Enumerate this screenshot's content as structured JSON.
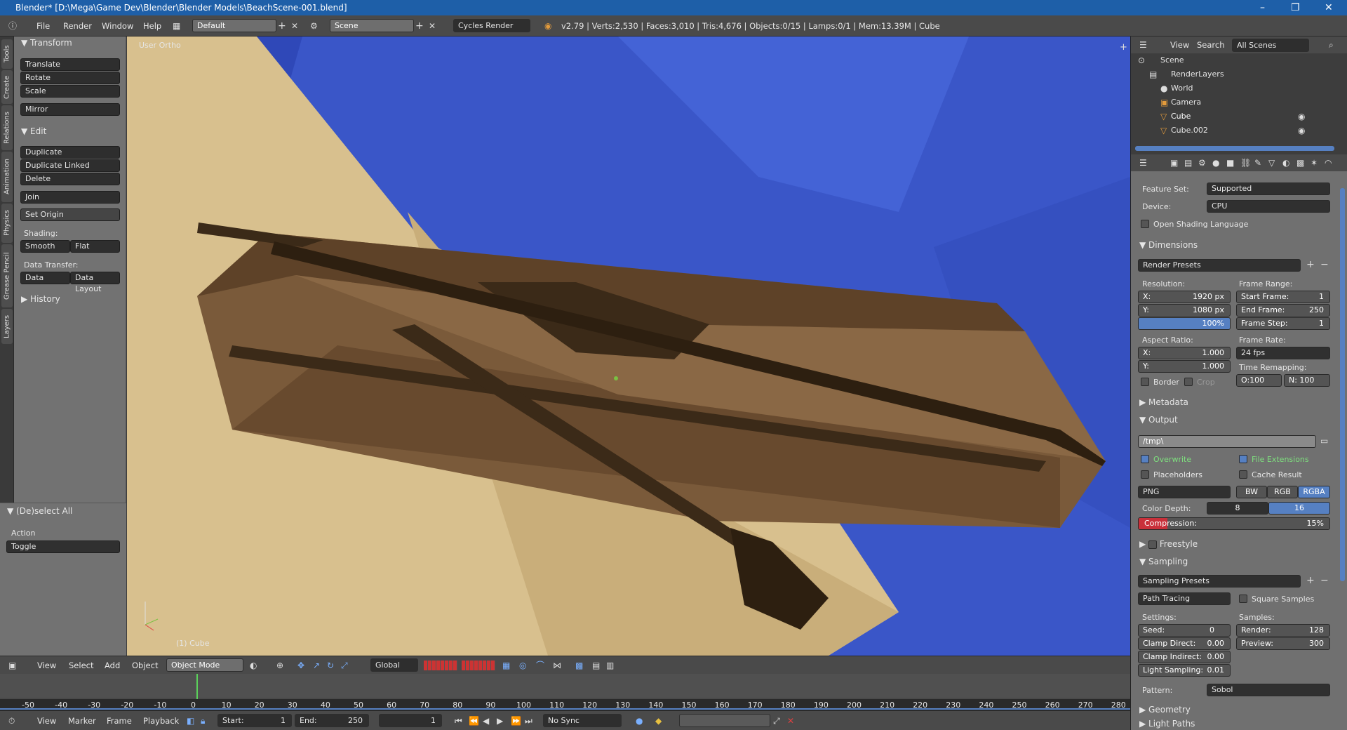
{
  "window": {
    "title": "Blender* [D:\\Mega\\Game Dev\\Blender\\Blender Models\\BeachScene-001.blend]"
  },
  "info_header": {
    "menus": [
      "File",
      "Render",
      "Window",
      "Help"
    ],
    "screen_layout": "Default",
    "scene": "Scene",
    "render_engine": "Cycles Render",
    "stats": "v2.79 | Verts:2,530 | Faces:3,010 | Tris:4,676 | Objects:0/15 | Lamps:0/1 | Mem:13.39M | Cube"
  },
  "tool_tabs": [
    "Tools",
    "Create",
    "Relations",
    "Animation",
    "Physics",
    "Grease Pencil",
    "Layers"
  ],
  "tool_shelf": {
    "transform_header": "Transform",
    "translate": "Translate",
    "rotate": "Rotate",
    "scale": "Scale",
    "mirror": "Mirror",
    "edit_header": "Edit",
    "duplicate": "Duplicate",
    "duplicate_linked": "Duplicate Linked",
    "delete": "Delete",
    "join": "Join",
    "set_origin": "Set Origin",
    "shading_label": "Shading:",
    "smooth": "Smooth",
    "flat": "Flat",
    "data_transfer_label": "Data Transfer:",
    "data": "Data",
    "data_layout": "Data Layout",
    "history_header": "History"
  },
  "operator_panel": {
    "header": "(De)select All",
    "action_label": "Action",
    "action_value": "Toggle"
  },
  "viewport": {
    "view_name": "User Ortho",
    "object_info": "(1) Cube"
  },
  "outliner": {
    "view": "View",
    "search": "Search",
    "filter": "All Scenes",
    "items": [
      "Scene",
      "RenderLayers",
      "World",
      "Camera",
      "Cube",
      "Cube.002"
    ]
  },
  "properties": {
    "feature_set_label": "Feature Set:",
    "feature_set": "Supported",
    "device_label": "Device:",
    "device": "CPU",
    "open_shading_language": "Open Shading Language",
    "dimensions_header": "Dimensions",
    "render_presets": "Render Presets",
    "resolution_label": "Resolution:",
    "res_x_label": "X:",
    "res_x": "1920 px",
    "res_y_label": "Y:",
    "res_y": "1080 px",
    "res_pct": "100%",
    "frame_range_label": "Frame Range:",
    "start_frame_label": "Start Frame:",
    "start_frame": "1",
    "end_frame_label": "End Frame:",
    "end_frame": "250",
    "frame_step_label": "Frame Step:",
    "frame_step": "1",
    "aspect_label": "Aspect Ratio:",
    "aspect_x_label": "X:",
    "aspect_x": "1.000",
    "aspect_y_label": "Y:",
    "aspect_y": "1.000",
    "frame_rate_label": "Frame Rate:",
    "frame_rate": "24 fps",
    "time_remap_label": "Time Remapping:",
    "remap_old": "O:100",
    "remap_new": "N: 100",
    "border": "Border",
    "crop": "Crop",
    "metadata_header": "Metadata",
    "output_header": "Output",
    "output_path": "/tmp\\",
    "overwrite": "Overwrite",
    "file_extensions": "File Extensions",
    "placeholders": "Placeholders",
    "cache_result": "Cache Result",
    "file_format": "PNG",
    "bw": "BW",
    "rgb": "RGB",
    "rgba": "RGBA",
    "color_depth_label": "Color Depth:",
    "depth_8": "8",
    "depth_16": "16",
    "compression_label": "Compression:",
    "compression": "15%",
    "compression_fraction": 0.15,
    "freestyle_header": "Freestyle",
    "sampling_header": "Sampling",
    "sampling_presets": "Sampling Presets",
    "integrator": "Path Tracing",
    "square_samples": "Square Samples",
    "settings_label": "Settings:",
    "samples_label": "Samples:",
    "seed_label": "Seed:",
    "seed": "0",
    "render_label": "Render:",
    "render_samples": "128",
    "clamp_direct_label": "Clamp Direct:",
    "clamp_direct": "0.00",
    "preview_label": "Preview:",
    "preview_samples": "300",
    "clamp_indirect_label": "Clamp Indirect:",
    "clamp_indirect": "0.00",
    "light_sampling_label": "Light Sampling:",
    "light_sampling": "0.01",
    "pattern_label": "Pattern:",
    "pattern": "Sobol",
    "geometry_header": "Geometry",
    "light_paths_header": "Light Paths"
  },
  "viewport_header": {
    "menus": [
      "View",
      "Select",
      "Add",
      "Object"
    ],
    "mode": "Object Mode",
    "orientation": "Global"
  },
  "timeline": {
    "ticks": [
      "-50",
      "-40",
      "-30",
      "-20",
      "-10",
      "0",
      "10",
      "20",
      "30",
      "40",
      "50",
      "60",
      "70",
      "80",
      "90",
      "100",
      "110",
      "120",
      "130",
      "140",
      "150",
      "160",
      "170",
      "180",
      "190",
      "200",
      "210",
      "220",
      "230",
      "240",
      "250",
      "260",
      "270",
      "280"
    ],
    "current_frame": 1,
    "menus": [
      "View",
      "Marker",
      "Frame",
      "Playback"
    ],
    "start_label": "Start:",
    "start": "1",
    "end_label": "End:",
    "end": "250",
    "frame": "1",
    "sync": "No Sync"
  },
  "colors": {
    "sea": "#3a56c8",
    "sand": "#d8c08e",
    "boat": "#7a5a3a",
    "accent_blue": "#5680c2",
    "compression_red": "#c9303a"
  }
}
